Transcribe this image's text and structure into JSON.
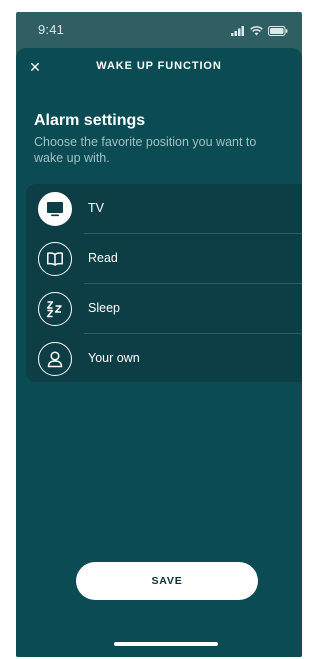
{
  "status_bar": {
    "time": "9:41"
  },
  "header": {
    "close_label": "✕",
    "title": "WAKE UP FUNCTION"
  },
  "section": {
    "title": "Alarm settings",
    "description": "Choose the favorite position you want to wake up with."
  },
  "options": [
    {
      "label": "TV",
      "icon": "tv-icon",
      "selected": true
    },
    {
      "label": "Read",
      "icon": "book-icon",
      "selected": false
    },
    {
      "label": "Sleep",
      "icon": "sleep-zzz-icon",
      "selected": false
    },
    {
      "label": "Your own",
      "icon": "user-icon",
      "selected": false
    }
  ],
  "actions": {
    "save_label": "SAVE"
  },
  "colors": {
    "background": "#2f5f62",
    "sheet": "#0b4c54",
    "card": "#0d3e45",
    "text": "#ffffff",
    "muted_text": "#9fc0c2"
  }
}
